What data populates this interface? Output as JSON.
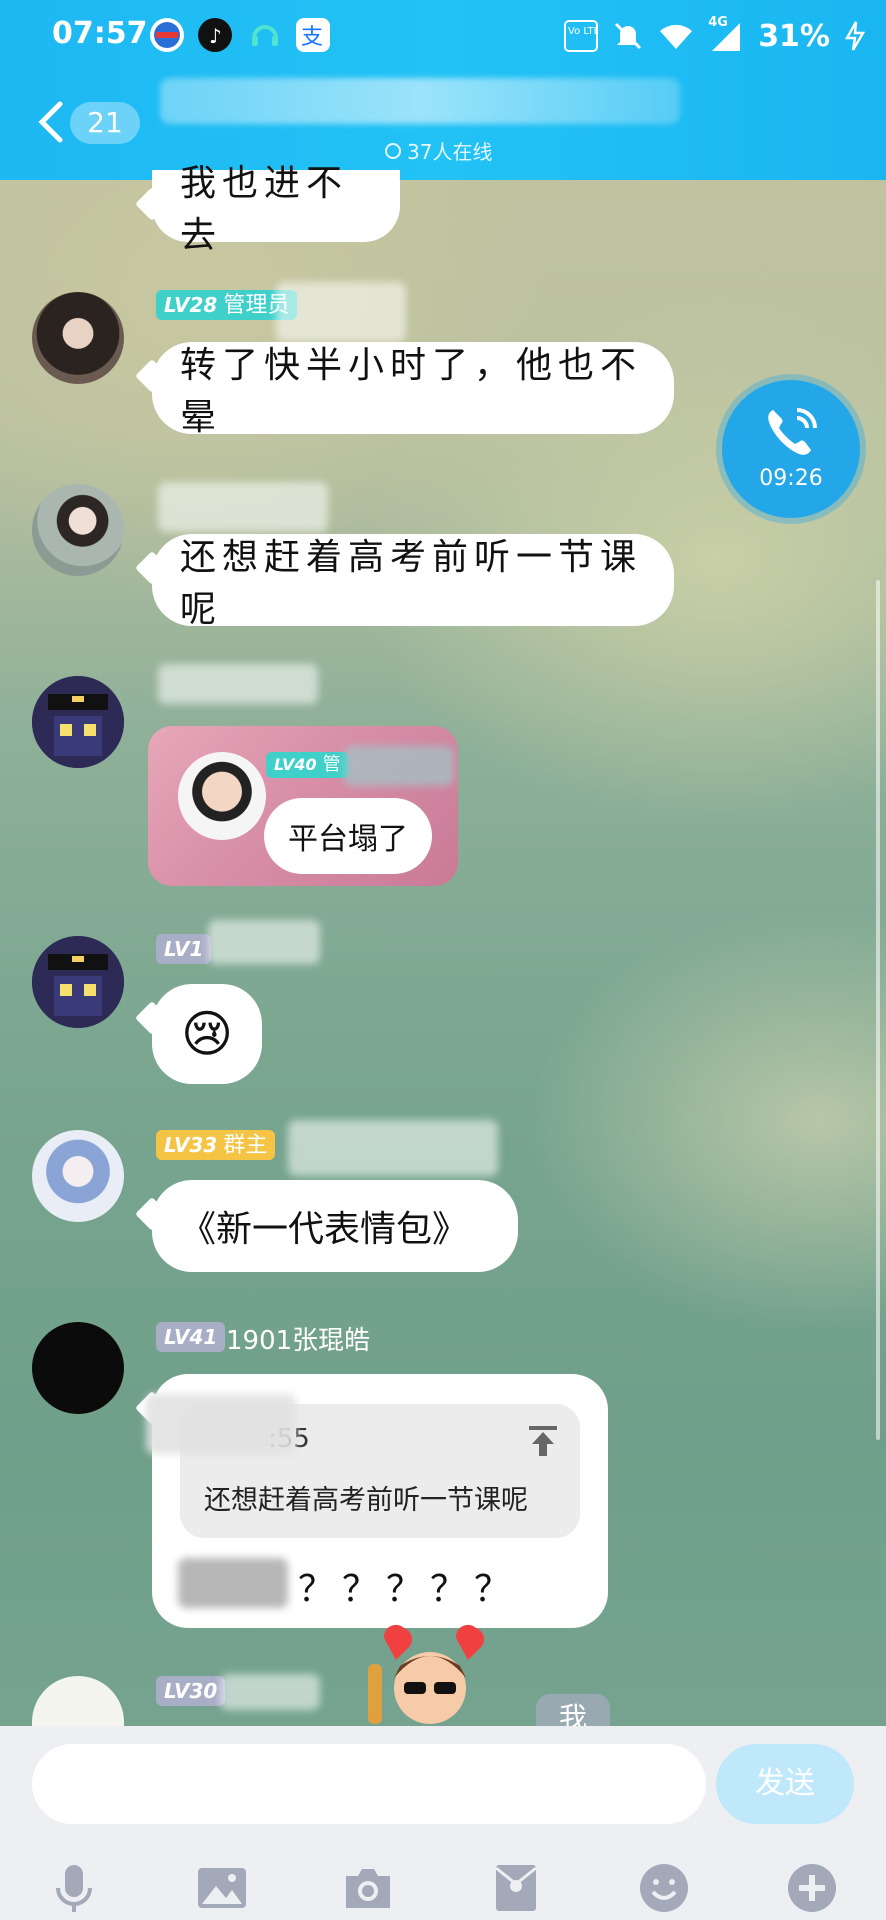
{
  "status_bar": {
    "time": "07:57",
    "network": "4G",
    "volte": "Vo LTE",
    "battery": "31%"
  },
  "header": {
    "back_icon": "chevron-left-icon",
    "unread_count": "21",
    "online_text": "37人在线"
  },
  "call": {
    "duration": "09:26"
  },
  "messages": [
    {
      "text": "我也进不去"
    },
    {
      "level": "LV28",
      "role": "管理员",
      "text": "转了快半小时了，他也不晕"
    },
    {
      "text": "还想赶着高考前听一节课呢"
    },
    {
      "sticker_level": "LV40",
      "sticker_role": "管",
      "sticker_text": "平台塌了"
    },
    {
      "level": "LV1",
      "emoji": "😢"
    },
    {
      "level": "LV33",
      "role": "群主",
      "text": "《新一代表情包》"
    },
    {
      "level": "LV41",
      "sender": "1901张琨皓",
      "quote_time": ":55",
      "quote_text": "还想赶着高考前听一节课呢",
      "reply_text": "？？？？？"
    },
    {
      "level": "LV30",
      "floating_label": "我"
    }
  ],
  "input_bar": {
    "send_label": "发送",
    "tools": [
      "microphone-icon",
      "image-icon",
      "camera-icon",
      "red-packet-icon",
      "emoji-icon",
      "plus-icon"
    ]
  },
  "colors": {
    "header": "#1eb8f3",
    "admin_badge": "#3fd0c9",
    "owner_badge": "#f5c445",
    "level_badge": "#a9aec7"
  }
}
